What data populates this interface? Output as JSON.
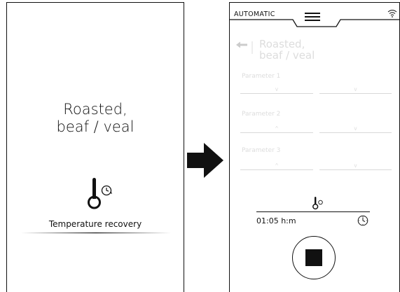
{
  "left_screen": {
    "title_line1": "Roasted,",
    "title_line2": "beaf / veal",
    "status_label": "Temperature recovery",
    "icon": "thermometer-clock-icon"
  },
  "arrow_icon": "right-arrow-icon",
  "right_screen": {
    "mode": "AUTOMATIC",
    "menu_icon": "hamburger-menu-icon",
    "wifi_icon": "wifi-icon",
    "back_icon": "back-arrow-icon",
    "title_line1": "Roasted,",
    "title_line2": "beaf / veal",
    "parameters": [
      {
        "label": "Parameter 1",
        "left_value": "v",
        "right_value": "v"
      },
      {
        "label": "Parameter 2",
        "left_value": "^",
        "right_value": "v"
      },
      {
        "label": "Parameter 3",
        "left_value": "^",
        "right_value": "v"
      }
    ],
    "timer_value": "01:05 h:m",
    "stop_icon": "stop-icon",
    "colors": {
      "faded_text": "#dddddd",
      "outline": "#111111"
    }
  }
}
